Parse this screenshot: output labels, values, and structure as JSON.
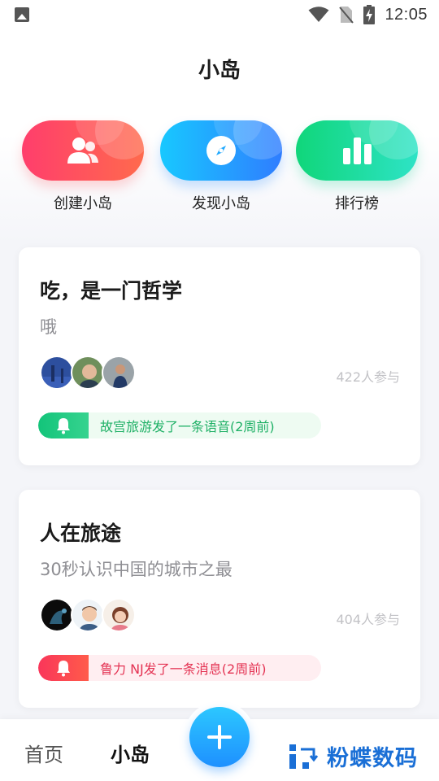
{
  "status_bar": {
    "time": "12:05"
  },
  "page": {
    "title": "小岛"
  },
  "actions": [
    {
      "label": "创建小岛",
      "icon": "users-icon",
      "color": "#ff4a63"
    },
    {
      "label": "发现小岛",
      "icon": "compass-icon",
      "color": "#1fa8ff"
    },
    {
      "label": "排行榜",
      "icon": "bar-chart-icon",
      "color": "#18d88f"
    }
  ],
  "cards": [
    {
      "title": "吃，是一门哲学",
      "subtitle": "哦",
      "count": "422人参与",
      "notice": "故宫旅游发了一条语音(2周前)",
      "notice_color": "#1fb066"
    },
    {
      "title": "人在旅途",
      "subtitle": "30秒认识中国的城市之最",
      "count": "404人参与",
      "notice": "鲁力 NJ发了一条消息(2周前)",
      "notice_color": "#e43353"
    }
  ],
  "bottom_nav": {
    "home": "首页",
    "island": "小岛"
  },
  "watermark": "粉蝶数码"
}
